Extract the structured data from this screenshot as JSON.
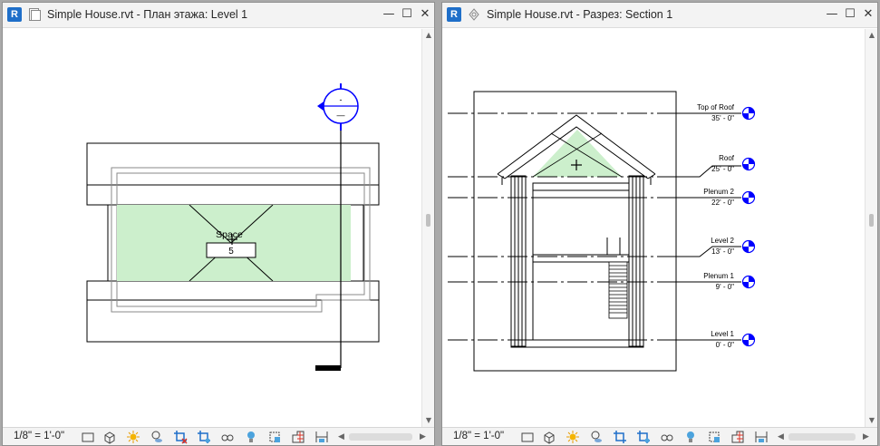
{
  "left_view": {
    "title": "Simple House.rvt - План этажа: Level 1",
    "space_label": "Space",
    "space_number": "5",
    "scale": "1/8\" = 1'-0\"",
    "section_head_top": "-",
    "section_head_bottom": "—"
  },
  "right_view": {
    "title": "Simple House.rvt - Разрез: Section 1",
    "scale": "1/8\" = 1'-0\"",
    "levels": [
      {
        "name": "Top of Roof",
        "elevation": "35' - 0\""
      },
      {
        "name": "Roof",
        "elevation": "25' - 0\""
      },
      {
        "name": "Plenum 2",
        "elevation": "22' - 0\""
      },
      {
        "name": "Level 2",
        "elevation": "13' - 0\""
      },
      {
        "name": "Plenum 1",
        "elevation": "9' - 0\""
      },
      {
        "name": "Level 1",
        "elevation": "0' - 0\""
      }
    ]
  },
  "window_controls": {
    "minimize": "—",
    "maximize": "☐",
    "close": "✕"
  },
  "app_icon_letter": "R",
  "colors": {
    "space_fill": "#ccefcc",
    "app_blue": "#1f6fc9",
    "section_blue": "#0000ff",
    "line": "#000000"
  },
  "toolbar_icons": [
    "detail-level-icon",
    "visual-style-icon",
    "sun-path-icon",
    "shadows-icon",
    "crop-view-icon",
    "show-crop-icon",
    "temporary-hide-icon",
    "reveal-hidden-icon",
    "analytical-model-icon",
    "highlight-displacement-icon",
    "constraints-icon",
    "thin-lines-icon"
  ]
}
